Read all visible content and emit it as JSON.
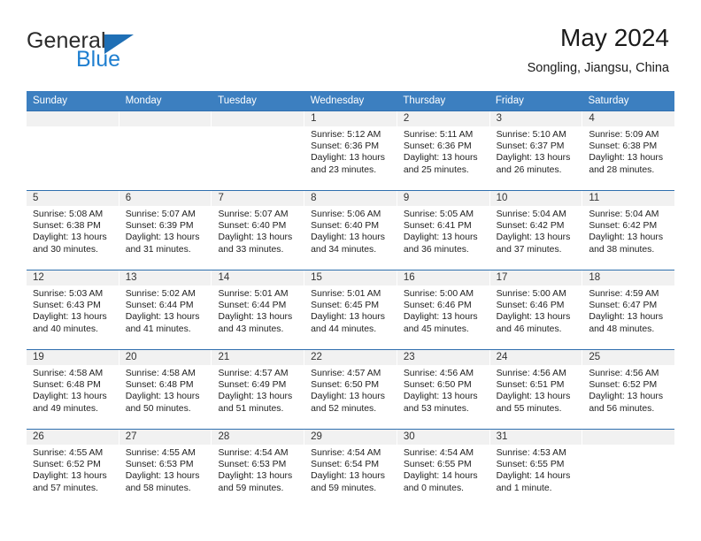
{
  "brand": {
    "name_top": "General",
    "name_bottom": "Blue",
    "triangle_color": "#1f6fb5",
    "blue_text_color": "#1f7fd0"
  },
  "header": {
    "title": "May 2024",
    "location": "Songling, Jiangsu, China",
    "header_bg": "#3c7fc0",
    "header_text_color": "#ffffff",
    "daynum_bg": "#f1f1f1",
    "row_border_color": "#2f6fae"
  },
  "weekdays": [
    "Sunday",
    "Monday",
    "Tuesday",
    "Wednesday",
    "Thursday",
    "Friday",
    "Saturday"
  ],
  "labels": {
    "sunrise_prefix": "Sunrise:",
    "sunset_prefix": "Sunset:",
    "daylight_prefix": "Daylight:"
  },
  "weeks": [
    [
      {
        "day": "",
        "empty": true
      },
      {
        "day": "",
        "empty": true
      },
      {
        "day": "",
        "empty": true
      },
      {
        "day": "1",
        "sunrise": "Sunrise: 5:12 AM",
        "sunset": "Sunset: 6:36 PM",
        "daylight_l1": "Daylight: 13 hours",
        "daylight_l2": "and 23 minutes."
      },
      {
        "day": "2",
        "sunrise": "Sunrise: 5:11 AM",
        "sunset": "Sunset: 6:36 PM",
        "daylight_l1": "Daylight: 13 hours",
        "daylight_l2": "and 25 minutes."
      },
      {
        "day": "3",
        "sunrise": "Sunrise: 5:10 AM",
        "sunset": "Sunset: 6:37 PM",
        "daylight_l1": "Daylight: 13 hours",
        "daylight_l2": "and 26 minutes."
      },
      {
        "day": "4",
        "sunrise": "Sunrise: 5:09 AM",
        "sunset": "Sunset: 6:38 PM",
        "daylight_l1": "Daylight: 13 hours",
        "daylight_l2": "and 28 minutes."
      }
    ],
    [
      {
        "day": "5",
        "sunrise": "Sunrise: 5:08 AM",
        "sunset": "Sunset: 6:38 PM",
        "daylight_l1": "Daylight: 13 hours",
        "daylight_l2": "and 30 minutes."
      },
      {
        "day": "6",
        "sunrise": "Sunrise: 5:07 AM",
        "sunset": "Sunset: 6:39 PM",
        "daylight_l1": "Daylight: 13 hours",
        "daylight_l2": "and 31 minutes."
      },
      {
        "day": "7",
        "sunrise": "Sunrise: 5:07 AM",
        "sunset": "Sunset: 6:40 PM",
        "daylight_l1": "Daylight: 13 hours",
        "daylight_l2": "and 33 minutes."
      },
      {
        "day": "8",
        "sunrise": "Sunrise: 5:06 AM",
        "sunset": "Sunset: 6:40 PM",
        "daylight_l1": "Daylight: 13 hours",
        "daylight_l2": "and 34 minutes."
      },
      {
        "day": "9",
        "sunrise": "Sunrise: 5:05 AM",
        "sunset": "Sunset: 6:41 PM",
        "daylight_l1": "Daylight: 13 hours",
        "daylight_l2": "and 36 minutes."
      },
      {
        "day": "10",
        "sunrise": "Sunrise: 5:04 AM",
        "sunset": "Sunset: 6:42 PM",
        "daylight_l1": "Daylight: 13 hours",
        "daylight_l2": "and 37 minutes."
      },
      {
        "day": "11",
        "sunrise": "Sunrise: 5:04 AM",
        "sunset": "Sunset: 6:42 PM",
        "daylight_l1": "Daylight: 13 hours",
        "daylight_l2": "and 38 minutes."
      }
    ],
    [
      {
        "day": "12",
        "sunrise": "Sunrise: 5:03 AM",
        "sunset": "Sunset: 6:43 PM",
        "daylight_l1": "Daylight: 13 hours",
        "daylight_l2": "and 40 minutes."
      },
      {
        "day": "13",
        "sunrise": "Sunrise: 5:02 AM",
        "sunset": "Sunset: 6:44 PM",
        "daylight_l1": "Daylight: 13 hours",
        "daylight_l2": "and 41 minutes."
      },
      {
        "day": "14",
        "sunrise": "Sunrise: 5:01 AM",
        "sunset": "Sunset: 6:44 PM",
        "daylight_l1": "Daylight: 13 hours",
        "daylight_l2": "and 43 minutes."
      },
      {
        "day": "15",
        "sunrise": "Sunrise: 5:01 AM",
        "sunset": "Sunset: 6:45 PM",
        "daylight_l1": "Daylight: 13 hours",
        "daylight_l2": "and 44 minutes."
      },
      {
        "day": "16",
        "sunrise": "Sunrise: 5:00 AM",
        "sunset": "Sunset: 6:46 PM",
        "daylight_l1": "Daylight: 13 hours",
        "daylight_l2": "and 45 minutes."
      },
      {
        "day": "17",
        "sunrise": "Sunrise: 5:00 AM",
        "sunset": "Sunset: 6:46 PM",
        "daylight_l1": "Daylight: 13 hours",
        "daylight_l2": "and 46 minutes."
      },
      {
        "day": "18",
        "sunrise": "Sunrise: 4:59 AM",
        "sunset": "Sunset: 6:47 PM",
        "daylight_l1": "Daylight: 13 hours",
        "daylight_l2": "and 48 minutes."
      }
    ],
    [
      {
        "day": "19",
        "sunrise": "Sunrise: 4:58 AM",
        "sunset": "Sunset: 6:48 PM",
        "daylight_l1": "Daylight: 13 hours",
        "daylight_l2": "and 49 minutes."
      },
      {
        "day": "20",
        "sunrise": "Sunrise: 4:58 AM",
        "sunset": "Sunset: 6:48 PM",
        "daylight_l1": "Daylight: 13 hours",
        "daylight_l2": "and 50 minutes."
      },
      {
        "day": "21",
        "sunrise": "Sunrise: 4:57 AM",
        "sunset": "Sunset: 6:49 PM",
        "daylight_l1": "Daylight: 13 hours",
        "daylight_l2": "and 51 minutes."
      },
      {
        "day": "22",
        "sunrise": "Sunrise: 4:57 AM",
        "sunset": "Sunset: 6:50 PM",
        "daylight_l1": "Daylight: 13 hours",
        "daylight_l2": "and 52 minutes."
      },
      {
        "day": "23",
        "sunrise": "Sunrise: 4:56 AM",
        "sunset": "Sunset: 6:50 PM",
        "daylight_l1": "Daylight: 13 hours",
        "daylight_l2": "and 53 minutes."
      },
      {
        "day": "24",
        "sunrise": "Sunrise: 4:56 AM",
        "sunset": "Sunset: 6:51 PM",
        "daylight_l1": "Daylight: 13 hours",
        "daylight_l2": "and 55 minutes."
      },
      {
        "day": "25",
        "sunrise": "Sunrise: 4:56 AM",
        "sunset": "Sunset: 6:52 PM",
        "daylight_l1": "Daylight: 13 hours",
        "daylight_l2": "and 56 minutes."
      }
    ],
    [
      {
        "day": "26",
        "sunrise": "Sunrise: 4:55 AM",
        "sunset": "Sunset: 6:52 PM",
        "daylight_l1": "Daylight: 13 hours",
        "daylight_l2": "and 57 minutes."
      },
      {
        "day": "27",
        "sunrise": "Sunrise: 4:55 AM",
        "sunset": "Sunset: 6:53 PM",
        "daylight_l1": "Daylight: 13 hours",
        "daylight_l2": "and 58 minutes."
      },
      {
        "day": "28",
        "sunrise": "Sunrise: 4:54 AM",
        "sunset": "Sunset: 6:53 PM",
        "daylight_l1": "Daylight: 13 hours",
        "daylight_l2": "and 59 minutes."
      },
      {
        "day": "29",
        "sunrise": "Sunrise: 4:54 AM",
        "sunset": "Sunset: 6:54 PM",
        "daylight_l1": "Daylight: 13 hours",
        "daylight_l2": "and 59 minutes."
      },
      {
        "day": "30",
        "sunrise": "Sunrise: 4:54 AM",
        "sunset": "Sunset: 6:55 PM",
        "daylight_l1": "Daylight: 14 hours",
        "daylight_l2": "and 0 minutes."
      },
      {
        "day": "31",
        "sunrise": "Sunrise: 4:53 AM",
        "sunset": "Sunset: 6:55 PM",
        "daylight_l1": "Daylight: 14 hours",
        "daylight_l2": "and 1 minute."
      },
      {
        "day": "",
        "empty": true
      }
    ]
  ]
}
